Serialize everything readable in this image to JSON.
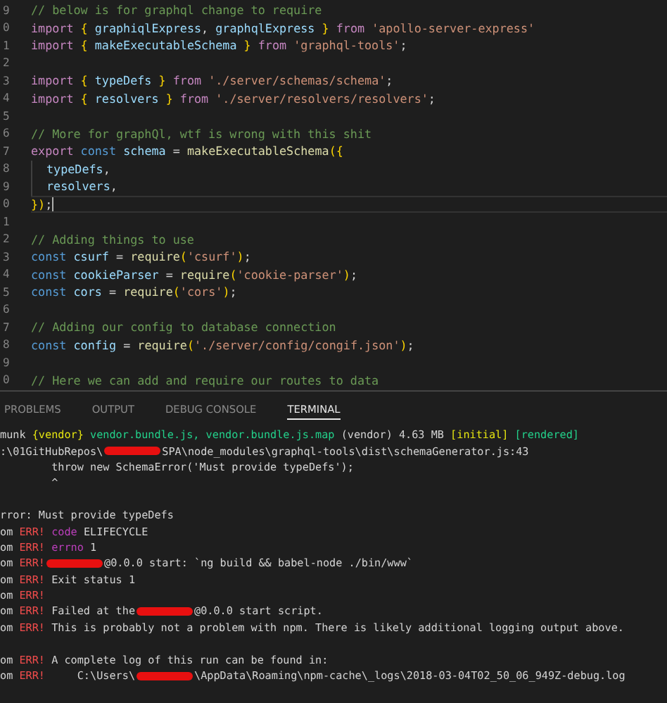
{
  "editor": {
    "lines": [
      {
        "num": "9",
        "current": false,
        "segs": [
          {
            "kind": "comment",
            "text": "// below is for graphql change to require"
          }
        ]
      },
      {
        "num": "0",
        "current": false,
        "segs": [
          {
            "kind": "import",
            "text": "import "
          },
          {
            "kind": "brace",
            "text": "{ "
          },
          {
            "kind": "ident",
            "text": "graphiqlExpress"
          },
          {
            "kind": "plain",
            "text": ", "
          },
          {
            "kind": "ident",
            "text": "graphqlExpress"
          },
          {
            "kind": "brace",
            "text": " }"
          },
          {
            "kind": "import",
            "text": " from "
          },
          {
            "kind": "string",
            "text": "'apollo-server-express'"
          }
        ]
      },
      {
        "num": "1",
        "current": false,
        "segs": [
          {
            "kind": "import",
            "text": "import "
          },
          {
            "kind": "brace",
            "text": "{ "
          },
          {
            "kind": "ident",
            "text": "makeExecutableSchema"
          },
          {
            "kind": "brace",
            "text": " }"
          },
          {
            "kind": "import",
            "text": " from "
          },
          {
            "kind": "string",
            "text": "'graphql-tools'"
          },
          {
            "kind": "plain",
            "text": ";"
          }
        ]
      },
      {
        "num": "2",
        "current": false
      },
      {
        "num": "3",
        "current": false,
        "segs": [
          {
            "kind": "import",
            "text": "import "
          },
          {
            "kind": "brace",
            "text": "{ "
          },
          {
            "kind": "ident",
            "text": "typeDefs"
          },
          {
            "kind": "brace",
            "text": " }"
          },
          {
            "kind": "import",
            "text": " from "
          },
          {
            "kind": "string",
            "text": "'./server/schemas/schema'"
          },
          {
            "kind": "plain",
            "text": ";"
          }
        ]
      },
      {
        "num": "4",
        "current": false,
        "segs": [
          {
            "kind": "import",
            "text": "import "
          },
          {
            "kind": "brace",
            "text": "{ "
          },
          {
            "kind": "ident",
            "text": "resolvers"
          },
          {
            "kind": "brace",
            "text": " }"
          },
          {
            "kind": "import",
            "text": " from "
          },
          {
            "kind": "string",
            "text": "'./server/resolvers/resolvers'"
          },
          {
            "kind": "plain",
            "text": ";"
          }
        ]
      },
      {
        "num": "5",
        "current": false
      },
      {
        "num": "6",
        "current": false,
        "segs": [
          {
            "kind": "comment",
            "text": "// More for graphQl, wtf is wrong with this shit"
          }
        ]
      },
      {
        "num": "7",
        "current": false,
        "segs": [
          {
            "kind": "import",
            "text": "export "
          },
          {
            "kind": "keyword",
            "text": "const "
          },
          {
            "kind": "ident",
            "text": "schema"
          },
          {
            "kind": "plain",
            "text": " = "
          },
          {
            "kind": "function",
            "text": "makeExecutableSchema"
          },
          {
            "kind": "brace",
            "text": "({"
          }
        ]
      },
      {
        "num": "8",
        "current": false,
        "indent": true,
        "segs": [
          {
            "kind": "ident",
            "text": "typeDefs"
          },
          {
            "kind": "plain",
            "text": ","
          }
        ]
      },
      {
        "num": "9",
        "current": false,
        "indent": true,
        "segs": [
          {
            "kind": "ident",
            "text": "resolvers"
          },
          {
            "kind": "plain",
            "text": ","
          }
        ]
      },
      {
        "num": "0",
        "current": true,
        "segs": [
          {
            "kind": "brace",
            "text": "})"
          },
          {
            "kind": "plain",
            "text": ";"
          }
        ]
      },
      {
        "num": "1",
        "current": false
      },
      {
        "num": "2",
        "current": false,
        "segs": [
          {
            "kind": "comment",
            "text": "// Adding things to use"
          }
        ]
      },
      {
        "num": "3",
        "current": false,
        "segs": [
          {
            "kind": "keyword",
            "text": "const "
          },
          {
            "kind": "ident",
            "text": "csurf"
          },
          {
            "kind": "plain",
            "text": " = "
          },
          {
            "kind": "function",
            "text": "require"
          },
          {
            "kind": "brace",
            "text": "("
          },
          {
            "kind": "string",
            "text": "'csurf'"
          },
          {
            "kind": "brace",
            "text": ")"
          },
          {
            "kind": "plain",
            "text": ";"
          }
        ]
      },
      {
        "num": "4",
        "current": false,
        "segs": [
          {
            "kind": "keyword",
            "text": "const "
          },
          {
            "kind": "ident",
            "text": "cookieParser"
          },
          {
            "kind": "plain",
            "text": " = "
          },
          {
            "kind": "function",
            "text": "require"
          },
          {
            "kind": "brace",
            "text": "("
          },
          {
            "kind": "string",
            "text": "'cookie-parser'"
          },
          {
            "kind": "brace",
            "text": ")"
          },
          {
            "kind": "plain",
            "text": ";"
          }
        ]
      },
      {
        "num": "5",
        "current": false,
        "segs": [
          {
            "kind": "keyword",
            "text": "const "
          },
          {
            "kind": "ident",
            "text": "cors"
          },
          {
            "kind": "plain",
            "text": " = "
          },
          {
            "kind": "function",
            "text": "require"
          },
          {
            "kind": "brace",
            "text": "("
          },
          {
            "kind": "string",
            "text": "'cors'"
          },
          {
            "kind": "brace",
            "text": ")"
          },
          {
            "kind": "plain",
            "text": ";"
          }
        ]
      },
      {
        "num": "6",
        "current": false
      },
      {
        "num": "7",
        "current": false,
        "segs": [
          {
            "kind": "comment",
            "text": "// Adding our config to database connection"
          }
        ]
      },
      {
        "num": "8",
        "current": false,
        "segs": [
          {
            "kind": "keyword",
            "text": "const "
          },
          {
            "kind": "ident",
            "text": "config"
          },
          {
            "kind": "plain",
            "text": " = "
          },
          {
            "kind": "function",
            "text": "require"
          },
          {
            "kind": "brace",
            "text": "("
          },
          {
            "kind": "string",
            "text": "'./server/config/congif.json'"
          },
          {
            "kind": "brace",
            "text": ")"
          },
          {
            "kind": "plain",
            "text": ";"
          }
        ]
      },
      {
        "num": "9",
        "current": false
      },
      {
        "num": "0",
        "current": false,
        "segs": [
          {
            "kind": "comment",
            "text": "// Here we can add and require our routes to data"
          }
        ]
      }
    ]
  },
  "panel": {
    "tabs": [
      {
        "label": "PROBLEMS",
        "selected": false
      },
      {
        "label": "OUTPUT",
        "selected": false
      },
      {
        "label": "DEBUG CONSOLE",
        "selected": false
      },
      {
        "label": "TERMINAL",
        "selected": true
      }
    ]
  },
  "terminal": {
    "lines": [
      {
        "parts": [
          {
            "kind": "text",
            "segs": [
              {
                "kind": "plain",
                "text": "munk "
              },
              {
                "kind": "yellow",
                "text": "{vendor} "
              },
              {
                "kind": "green",
                "text": "vendor.bundle.js, vendor.bundle.js.map"
              },
              {
                "kind": "plain",
                "text": " (vendor) 4.63 MB "
              },
              {
                "kind": "yellow",
                "text": "[initial] "
              },
              {
                "kind": "green",
                "text": "[rendered]"
              }
            ]
          }
        ]
      },
      {
        "parts": [
          {
            "kind": "text",
            "segs": [
              {
                "kind": "plain",
                "text": ":\\01GitHubRepos\\"
              }
            ]
          },
          {
            "kind": "redaction"
          },
          {
            "kind": "text",
            "segs": [
              {
                "kind": "plain",
                "text": "SPA\\node_modules\\graphql-tools\\dist\\schemaGenerator.js:43"
              }
            ]
          }
        ]
      },
      {
        "parts": [
          {
            "kind": "text",
            "segs": [
              {
                "kind": "plain",
                "text": "        throw new SchemaError('Must provide typeDefs');"
              }
            ]
          }
        ]
      },
      {
        "parts": [
          {
            "kind": "text",
            "segs": [
              {
                "kind": "plain",
                "text": "        ^"
              }
            ]
          }
        ]
      },
      {
        "space_before": true,
        "parts": [
          {
            "kind": "text",
            "segs": [
              {
                "kind": "plain",
                "text": "rror: Must provide typeDefs"
              }
            ]
          }
        ]
      },
      {
        "parts": [
          {
            "kind": "text",
            "segs": [
              {
                "kind": "plain",
                "text": "om "
              },
              {
                "kind": "red",
                "text": "ERR! "
              },
              {
                "kind": "purple",
                "text": "code"
              },
              {
                "kind": "plain",
                "text": " ELIFECYCLE"
              }
            ]
          }
        ]
      },
      {
        "parts": [
          {
            "kind": "text",
            "segs": [
              {
                "kind": "plain",
                "text": "om "
              },
              {
                "kind": "red",
                "text": "ERR! "
              },
              {
                "kind": "purple",
                "text": "errno"
              },
              {
                "kind": "plain",
                "text": " 1"
              }
            ]
          }
        ]
      },
      {
        "parts": [
          {
            "kind": "text",
            "segs": [
              {
                "kind": "plain",
                "text": "om "
              },
              {
                "kind": "red",
                "text": "ERR!"
              }
            ]
          },
          {
            "kind": "redaction"
          },
          {
            "kind": "text",
            "segs": [
              {
                "kind": "plain",
                "text": "@0.0.0 start: `ng build && babel-node ./bin/www`"
              }
            ]
          }
        ]
      },
      {
        "parts": [
          {
            "kind": "text",
            "segs": [
              {
                "kind": "plain",
                "text": "om "
              },
              {
                "kind": "red",
                "text": "ERR! "
              },
              {
                "kind": "plain",
                "text": "Exit status 1"
              }
            ]
          }
        ]
      },
      {
        "parts": [
          {
            "kind": "text",
            "segs": [
              {
                "kind": "plain",
                "text": "om "
              },
              {
                "kind": "red",
                "text": "ERR!"
              }
            ]
          }
        ]
      },
      {
        "parts": [
          {
            "kind": "text",
            "segs": [
              {
                "kind": "plain",
                "text": "om "
              },
              {
                "kind": "red",
                "text": "ERR! "
              },
              {
                "kind": "plain",
                "text": "Failed at the"
              }
            ]
          },
          {
            "kind": "redaction"
          },
          {
            "kind": "text",
            "segs": [
              {
                "kind": "plain",
                "text": "@0.0.0 start script."
              }
            ]
          }
        ]
      },
      {
        "parts": [
          {
            "kind": "text",
            "segs": [
              {
                "kind": "plain",
                "text": "om "
              },
              {
                "kind": "red",
                "text": "ERR! "
              },
              {
                "kind": "plain",
                "text": "This is probably not a problem with npm. There is likely additional logging output above."
              }
            ]
          }
        ]
      },
      {
        "space_before": true,
        "parts": [
          {
            "kind": "text",
            "segs": [
              {
                "kind": "plain",
                "text": "om "
              },
              {
                "kind": "red",
                "text": "ERR! "
              },
              {
                "kind": "plain",
                "text": "A complete log of this run can be found in:"
              }
            ]
          }
        ]
      },
      {
        "parts": [
          {
            "kind": "text",
            "segs": [
              {
                "kind": "plain",
                "text": "om "
              },
              {
                "kind": "red",
                "text": "ERR! "
              },
              {
                "kind": "plain",
                "text": "    C:\\Users\\"
              }
            ]
          },
          {
            "kind": "redaction"
          },
          {
            "kind": "text",
            "segs": [
              {
                "kind": "plain",
                "text": "\\AppData\\Roaming\\npm-cache\\_logs\\2018-03-04T02_50_06_949Z-debug.log"
              }
            ]
          }
        ]
      }
    ]
  }
}
